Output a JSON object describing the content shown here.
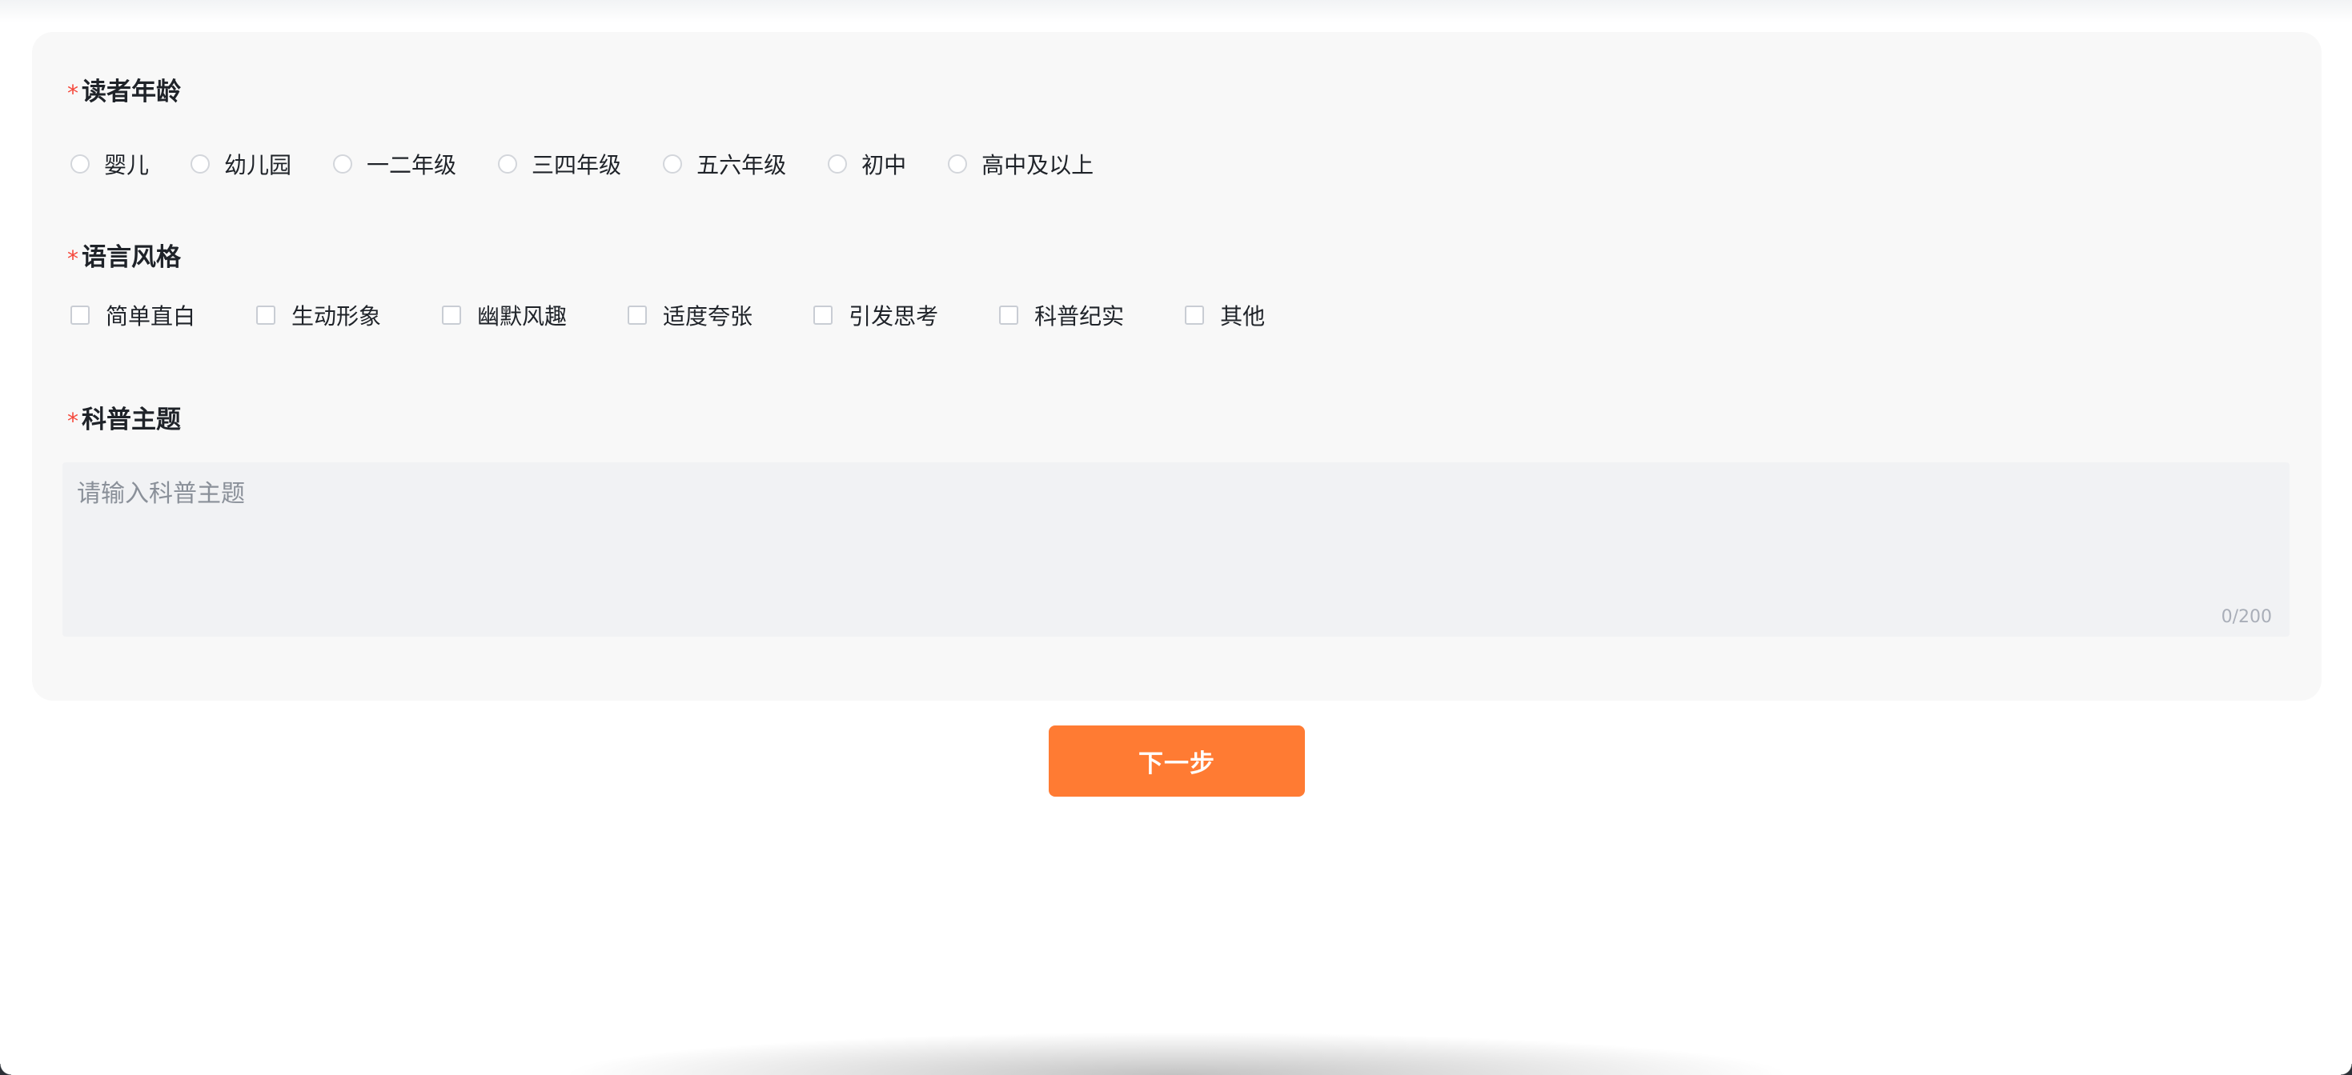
{
  "reader_age": {
    "required_mark": "*",
    "label": "读者年龄",
    "options": [
      "婴儿",
      "幼儿园",
      "一二年级",
      "三四年级",
      "五六年级",
      "初中",
      "高中及以上"
    ]
  },
  "language_style": {
    "required_mark": "*",
    "label": "语言风格",
    "options": [
      "简单直白",
      "生动形象",
      "幽默风趣",
      "适度夸张",
      "引发思考",
      "科普纪实",
      "其他"
    ]
  },
  "science_topic": {
    "required_mark": "*",
    "label": "科普主题",
    "placeholder": "请输入科普主题",
    "value": "",
    "counter": "0/200"
  },
  "next_button": {
    "label": "下一步"
  },
  "colors": {
    "accent": "#ff7b33",
    "required": "#f5483b",
    "card_bg": "#f8f8f8",
    "input_bg": "#f1f2f4"
  }
}
